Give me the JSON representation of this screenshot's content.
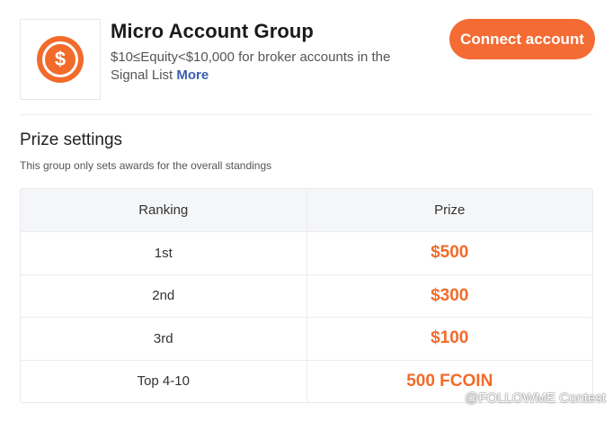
{
  "header": {
    "logo_glyph": "$",
    "title": "Micro Account Group",
    "description": "$10≤Equity<$10,000 for broker accounts in the Signal List",
    "more_link": "More",
    "connect_button": "Connect account"
  },
  "prize_settings": {
    "title": "Prize settings",
    "subtitle": "This group only sets awards for the overall standings",
    "columns": [
      "Ranking",
      "Prize"
    ],
    "rows": [
      {
        "ranking": "1st",
        "prize": "$500"
      },
      {
        "ranking": "2nd",
        "prize": "$300"
      },
      {
        "ranking": "3rd",
        "prize": "$100"
      },
      {
        "ranking": "Top 4-10",
        "prize": "500 FCOIN"
      }
    ]
  },
  "watermark": "@FOLLOWME Contest",
  "colors": {
    "accent": "#f46b34",
    "prize_text": "#f26b2a",
    "link": "#3a5fb0",
    "table_header_bg": "#f5f6f8"
  }
}
